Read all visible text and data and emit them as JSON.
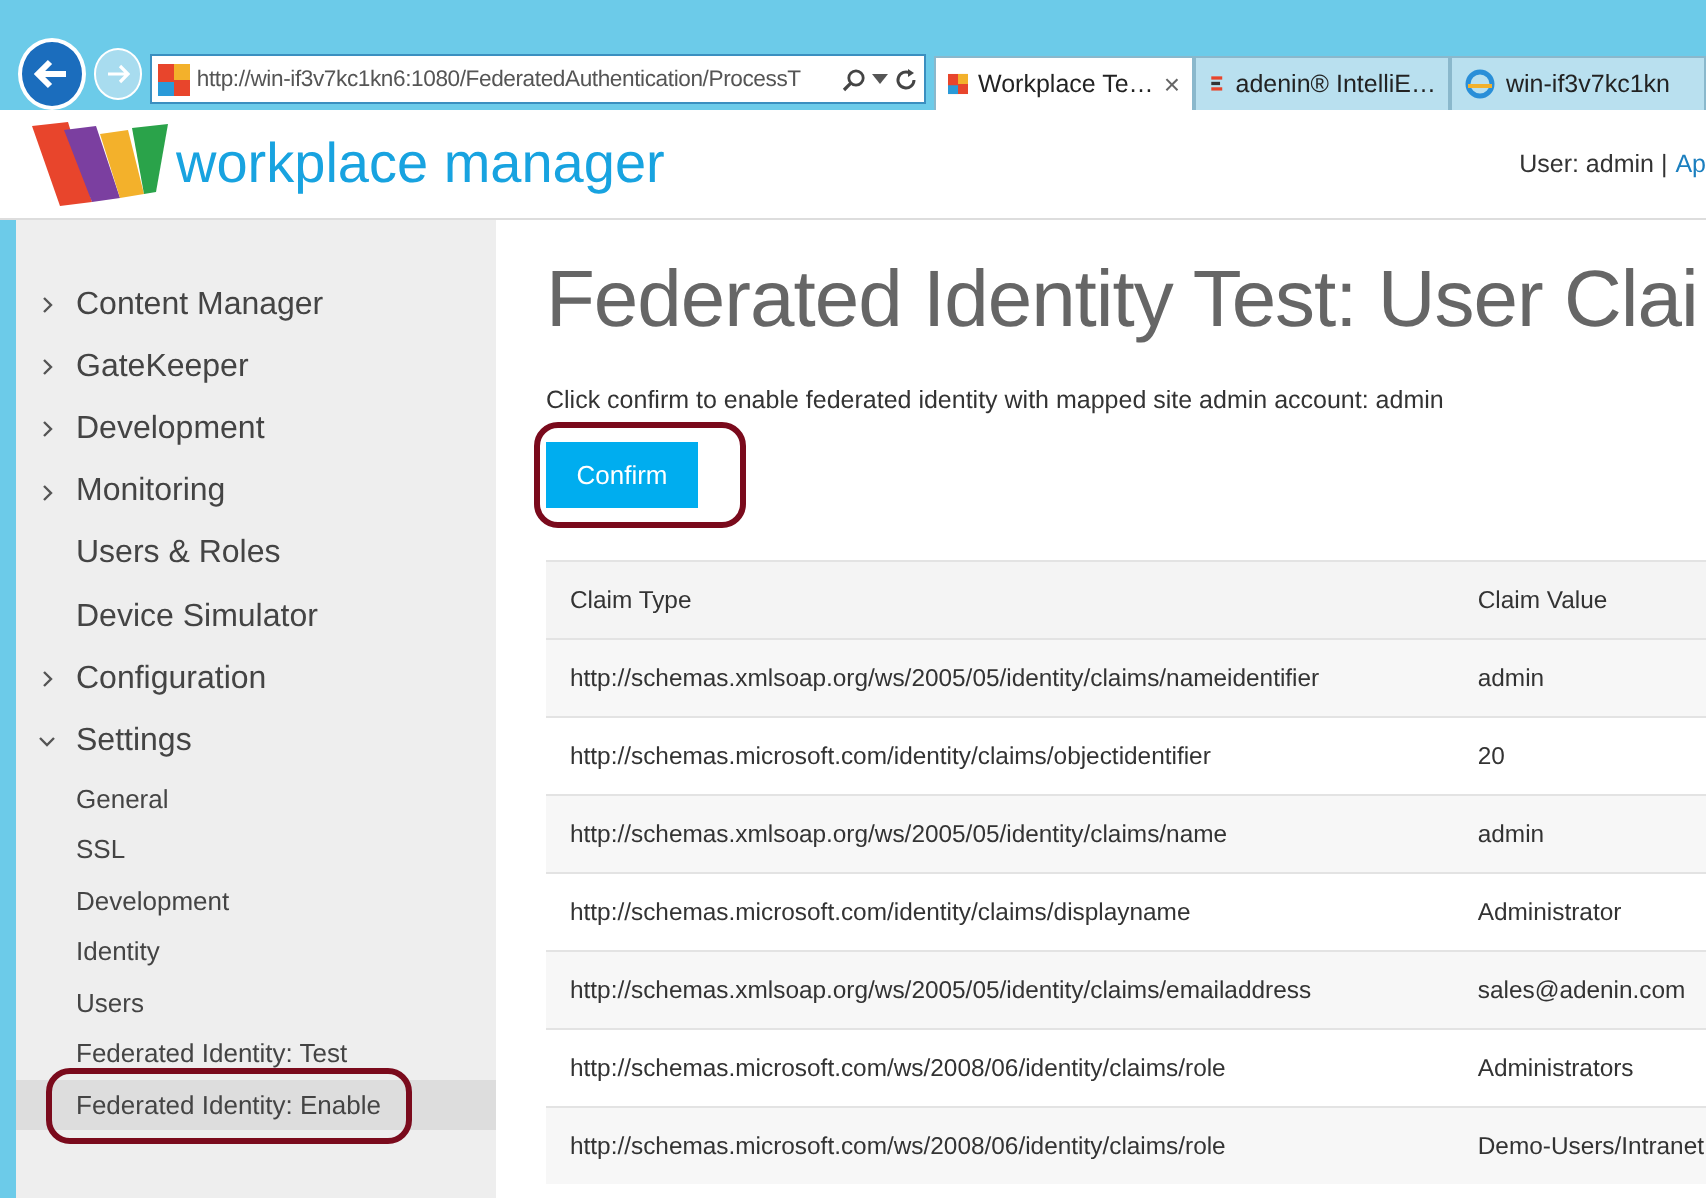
{
  "browser": {
    "address": "http://win-if3v7kc1kn6:1080/FederatedAuthentication/ProcessT",
    "tabs": [
      {
        "label": "Workplace Te…",
        "selected": true,
        "close": "×"
      },
      {
        "label": "adenin® IntelliE…",
        "selected": false
      },
      {
        "label": "win-if3v7kc1kn",
        "selected": false
      }
    ]
  },
  "header": {
    "logo_text": "workplace manager",
    "user": "User: admin |",
    "link": "Ap"
  },
  "sidebar": {
    "items": [
      {
        "label": "Content Manager",
        "kind": "group",
        "expanded": false
      },
      {
        "label": "GateKeeper",
        "kind": "group",
        "expanded": false
      },
      {
        "label": "Development",
        "kind": "group",
        "expanded": false
      },
      {
        "label": "Monitoring",
        "kind": "group",
        "expanded": false
      },
      {
        "label": "Users & Roles",
        "kind": "link"
      },
      {
        "label": "Device Simulator",
        "kind": "link"
      },
      {
        "label": "Configuration",
        "kind": "group",
        "expanded": false
      },
      {
        "label": "Settings",
        "kind": "group",
        "expanded": true,
        "children": [
          {
            "label": "General",
            "selected": false
          },
          {
            "label": "SSL",
            "selected": false
          },
          {
            "label": "Development",
            "selected": false
          },
          {
            "label": "Identity",
            "selected": false
          },
          {
            "label": "Users",
            "selected": false
          },
          {
            "label": "Federated Identity: Test",
            "selected": false
          },
          {
            "label": "Federated Identity: Enable",
            "selected": true,
            "highlighted": true
          }
        ]
      }
    ]
  },
  "main": {
    "title": "Federated Identity Test: User Clai",
    "description": "Click confirm to enable federated identity with mapped site admin account: admin",
    "confirm_button": {
      "label": "Confirm",
      "highlighted": true
    },
    "table": {
      "columns": [
        "Claim Type",
        "Claim Value"
      ],
      "rows": [
        [
          "http://schemas.xmlsoap.org/ws/2005/05/identity/claims/nameidentifier",
          "admin"
        ],
        [
          "http://schemas.microsoft.com/identity/claims/objectidentifier",
          "20"
        ],
        [
          "http://schemas.xmlsoap.org/ws/2005/05/identity/claims/name",
          "admin"
        ],
        [
          "http://schemas.microsoft.com/identity/claims/displayname",
          "Administrator"
        ],
        [
          "http://schemas.xmlsoap.org/ws/2005/05/identity/claims/emailaddress",
          "sales@adenin.com"
        ],
        [
          "http://schemas.microsoft.com/ws/2008/06/identity/claims/role",
          "Administrators"
        ],
        [
          "http://schemas.microsoft.com/ws/2008/06/identity/claims/role",
          "Demo-Users/Intranet"
        ]
      ]
    }
  }
}
